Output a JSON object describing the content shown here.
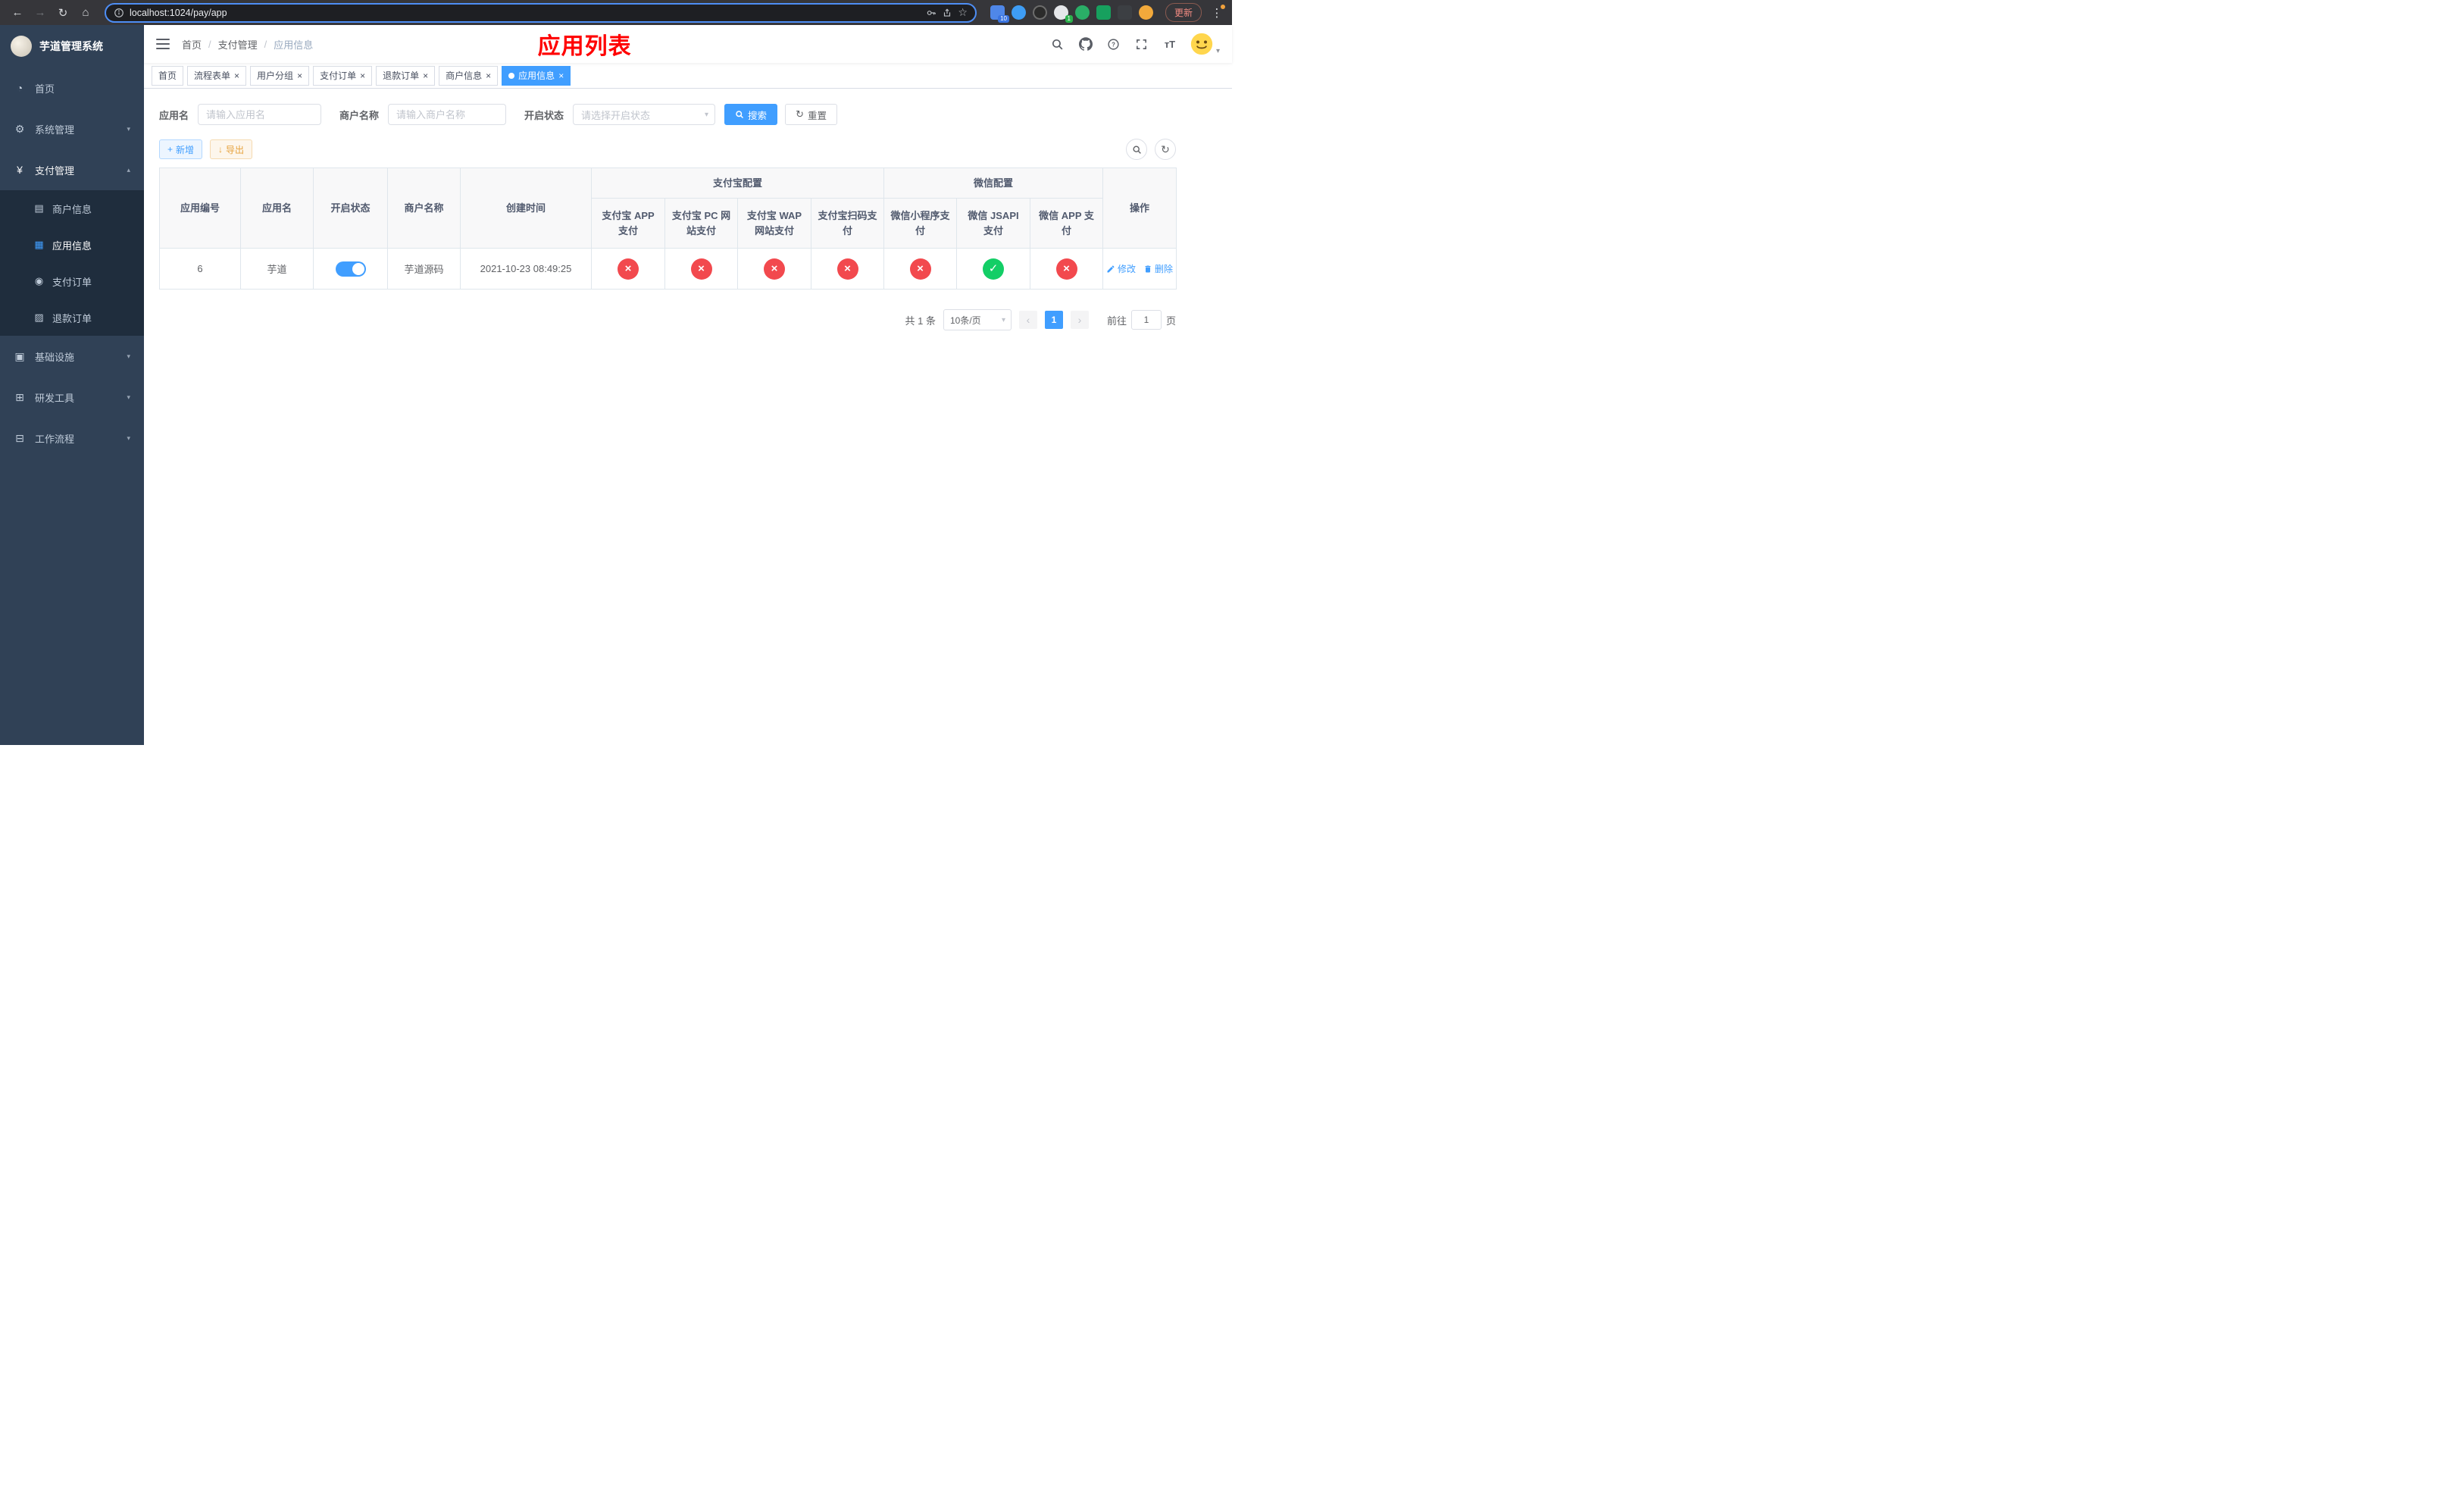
{
  "colors": {
    "accent": "#409eff",
    "title_red": "#ff0000",
    "status_disabled": "#f2494e",
    "status_enabled": "#13ce66",
    "sidebar_bg": "#304156",
    "submenu_bg": "#1f2d3d"
  },
  "icons": {
    "back": "←",
    "forward": "→",
    "reload": "↻",
    "home": "⌂",
    "star": "☆",
    "kebab": "⋮",
    "plus": "+",
    "download": "↓",
    "refresh": "↻",
    "close": "×",
    "check": "✓",
    "cross": "×",
    "caret_down": "▾",
    "caret_up": "▴",
    "prev": "‹",
    "next": "›",
    "font_size": "тT",
    "dashboard": "◔",
    "gear": "⚙",
    "yen": "¥",
    "merchant": "▤",
    "app": "▦",
    "order": "◉",
    "refund": "▨",
    "infra": "▣",
    "devtool": "⊞",
    "workflow": "⊟"
  },
  "browser": {
    "url": "localhost:1024/pay/app",
    "update_label": "更新",
    "extension_badges": [
      "10",
      "1"
    ]
  },
  "sidebar": {
    "title": "芋道管理系统",
    "items": [
      {
        "label": "首页"
      },
      {
        "label": "系统管理"
      },
      {
        "label": "支付管理",
        "children": [
          {
            "label": "商户信息"
          },
          {
            "label": "应用信息"
          },
          {
            "label": "支付订单"
          },
          {
            "label": "退款订单"
          }
        ]
      },
      {
        "label": "基础设施"
      },
      {
        "label": "研发工具"
      },
      {
        "label": "工作流程"
      }
    ]
  },
  "header": {
    "breadcrumb": [
      "首页",
      "支付管理",
      "应用信息"
    ],
    "page_title": "应用列表"
  },
  "tabs": [
    {
      "label": "首页"
    },
    {
      "label": "流程表单"
    },
    {
      "label": "用户分组"
    },
    {
      "label": "支付订单"
    },
    {
      "label": "退款订单"
    },
    {
      "label": "商户信息"
    },
    {
      "label": "应用信息"
    }
  ],
  "filters": {
    "app_name_label": "应用名",
    "app_name_placeholder": "请输入应用名",
    "merchant_label": "商户名称",
    "merchant_placeholder": "请输入商户名称",
    "status_label": "开启状态",
    "status_placeholder": "请选择开启状态",
    "search_label": "搜索",
    "reset_label": "重置"
  },
  "toolbar": {
    "add_label": "新增",
    "export_label": "导出"
  },
  "table": {
    "group_alipay": "支付宝配置",
    "group_wechat": "微信配置",
    "columns": [
      "应用编号",
      "应用名",
      "开启状态",
      "商户名称",
      "创建时间",
      "支付宝 APP 支付",
      "支付宝 PC 网站支付",
      "支付宝 WAP 网站支付",
      "支付宝扫码支付",
      "微信小程序支付",
      "微信 JSAPI 支付",
      "微信 APP 支付",
      "操作"
    ],
    "row": {
      "id": "6",
      "app_name": "芋道",
      "status_on": true,
      "merchant": "芋道源码",
      "created_at": "2021-10-23 08:49:25",
      "payment_status": {
        "alipay_app": false,
        "alipay_pc": false,
        "alipay_wap": false,
        "alipay_qr": false,
        "wechat_mini": false,
        "wechat_jsapi": true,
        "wechat_app": false
      },
      "edit_label": "修改",
      "delete_label": "删除"
    }
  },
  "pagination": {
    "total": "共 1 条",
    "page_size": "10条/页",
    "current_page": "1",
    "goto_label": "前往",
    "goto_value": "1",
    "unit_label": "页"
  }
}
